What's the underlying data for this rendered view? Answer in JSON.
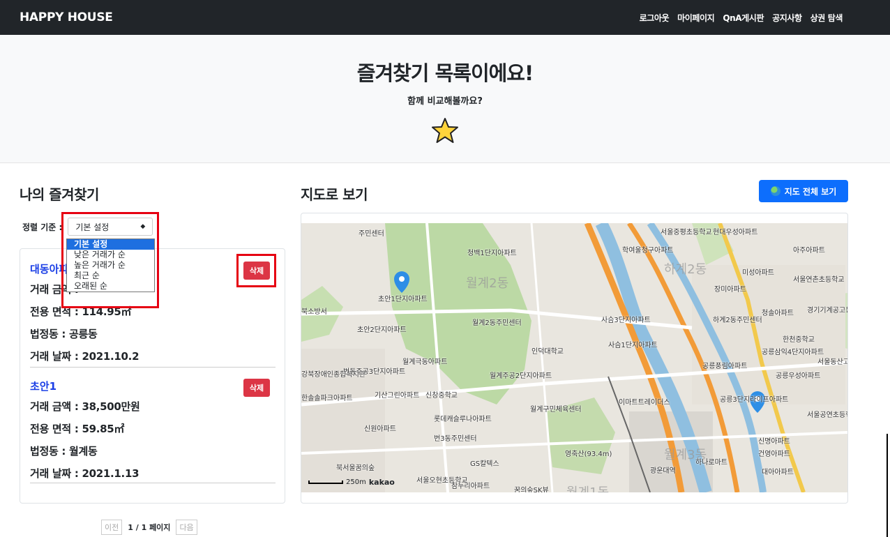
{
  "nav": {
    "brand": "HAPPY HOUSE",
    "links": [
      "로그아웃",
      "마이페이지",
      "QnA게시판",
      "공지사항",
      "상권 탐색"
    ]
  },
  "hero": {
    "title": "즐겨찾기 목록이에요!",
    "subtitle": "함께 비교해볼까요?"
  },
  "favorites": {
    "title": "나의 즐겨찾기",
    "sort_label": "정렬 기준 :",
    "sort_value": "기본 설정",
    "sort_options": [
      "기본 설정",
      "낮은 거래가 순",
      "높은 거래가 순",
      "최근 순",
      "오래된 순"
    ],
    "items": [
      {
        "name": "대동아파트",
        "price": "거래 금액 :",
        "area": "전용 면적 : 114.95㎡",
        "dong": "법정동 : 공릉동",
        "date": "거래 날짜 : 2021.10.2",
        "delete": "삭제"
      },
      {
        "name": "초안1",
        "price": "거래 금액 : 38,500만원",
        "area": "전용 면적 : 59.85㎡",
        "dong": "법정동 : 월계동",
        "date": "거래 날짜 : 2021.1.13",
        "delete": "삭제"
      }
    ],
    "pagination": {
      "prev": "이전",
      "info": "1 / 1 페이지",
      "next": "다음"
    }
  },
  "map": {
    "title": "지도로 보기",
    "button": "지도 전체 보기",
    "regions": [
      "월계2동",
      "하계2동",
      "월계3동",
      "월계1동"
    ],
    "labels": [
      "주민센터",
      "서울중평초등학교",
      "현대우성아파트",
      "청백1단지아파트",
      "학여울청구아파트",
      "아주아파트",
      "미성아파트",
      "서울연촌초등학교",
      "장미아파트",
      "초안1단지아파트",
      "북소방서",
      "월계2동주민센터",
      "사슴3단지아파트",
      "하계2동주민센터",
      "청솔아파트",
      "경기기계공고등학교",
      "초안2단지아파트",
      "인덕대학교",
      "사슴1단지아파트",
      "한천중학교",
      "공릉삼익4단지아파트",
      "서울동산고등학교",
      "월계극동아파트",
      "공릉풍림아파트",
      "강북장애인종합복지관",
      "번동주공3단지아파트",
      "월계주공2단지아파트",
      "공릉우성아파트",
      "신창중학교",
      "한솔솔파크아파트",
      "기산그린아파트",
      "이마트트레이더스",
      "공릉3단지라이프아파트",
      "월계구민체육센터",
      "롯데캐슬루나아파트",
      "서울공연초등학교",
      "신원아파트",
      "번3동주민센터",
      "영축산(93.4m)",
      "신명아파트",
      "GS칼텍스",
      "건영아파트",
      "북서울꿈의숲",
      "하나로마트",
      "광운대역",
      "대아아파트",
      "서울오현초등학교",
      "참누리아파트",
      "꿈의숲SK뷰"
    ],
    "scale": "250m",
    "logo": "kakao"
  }
}
